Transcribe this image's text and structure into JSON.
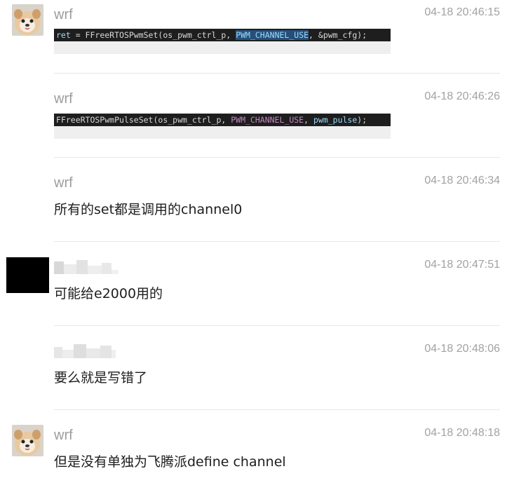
{
  "messages": [
    {
      "sender": "wrf",
      "time": "04-18 20:46:15",
      "code": {
        "prefix": "ret",
        "middle": " = FFreeRTOSPwmSet(os_pwm_ctrl_p, ",
        "macro": "PWM_CHANNEL_USE",
        "suffix": ", &pwm_cfg);"
      }
    },
    {
      "sender": "wrf",
      "time": "04-18 20:46:26",
      "code": {
        "middle": "FFreeRTOSPwmPulseSet(os_pwm_ctrl_p, ",
        "macro": "PWM_CHANNEL_USE",
        "suffix_sep": ", ",
        "var": "pwm_pulse",
        "suffix": ");"
      }
    },
    {
      "sender": "wrf",
      "time": "04-18 20:46:34",
      "text": "所有的set都是调用的channel0"
    },
    {
      "time": "04-18 20:47:51",
      "text": "可能给e2000用的"
    },
    {
      "time": "04-18 20:48:06",
      "text": "要么就是写错了"
    },
    {
      "sender": "wrf",
      "time": "04-18 20:48:18",
      "text": "但是没有单独为飞腾派define channel"
    }
  ]
}
